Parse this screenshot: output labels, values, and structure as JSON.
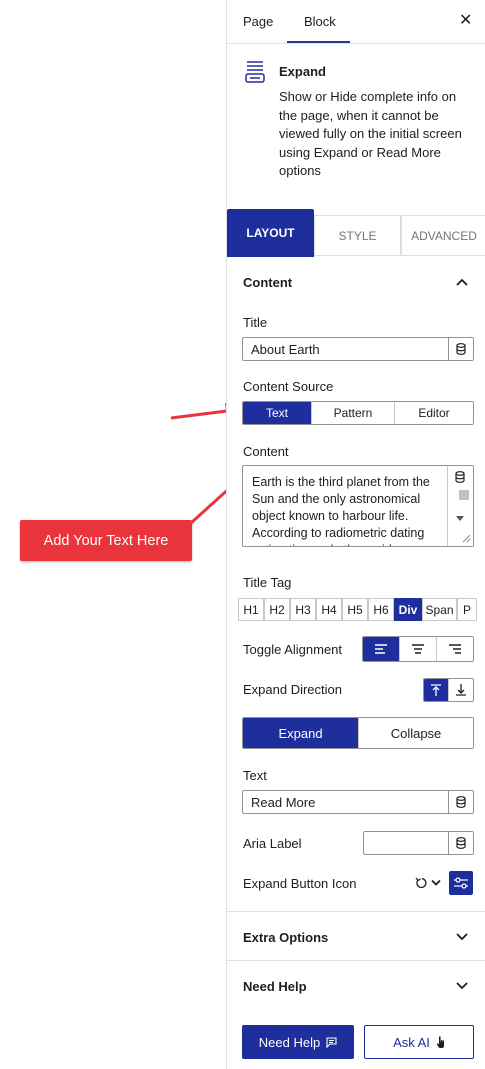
{
  "header": {
    "tabs": [
      "Page",
      "Block"
    ],
    "active_tab": "Block"
  },
  "block": {
    "title": "Expand",
    "description": "Show or Hide complete info on the page, when it cannot be viewed fully on the initial screen using Expand or Read More options"
  },
  "inspector_tabs": [
    "LAYOUT",
    "STYLE",
    "ADVANCED"
  ],
  "content_section": {
    "title": "Content",
    "title_label": "Title",
    "title_value": "About Earth",
    "source_label": "Content Source",
    "source_options": [
      "Text",
      "Pattern",
      "Editor"
    ],
    "source_selected": "Text",
    "content_label": "Content",
    "content_value": "Earth is the third planet from the Sun and the only astronomical object known to harbour life. According to radiometric dating estimation and other evidence",
    "title_tag_label": "Title Tag",
    "title_tags": [
      "H1",
      "H2",
      "H3",
      "H4",
      "H5",
      "H6",
      "Div",
      "Span",
      "P"
    ],
    "title_tag_selected": "Div",
    "toggle_alignment_label": "Toggle Alignment",
    "expand_direction_label": "Expand Direction",
    "state_options": [
      "Expand",
      "Collapse"
    ],
    "state_selected": "Expand",
    "text_label": "Text",
    "text_value": "Read More",
    "aria_label": "Aria Label",
    "aria_value": "",
    "expand_icon_label": "Expand Button Icon"
  },
  "extra_options": {
    "title": "Extra Options"
  },
  "need_help": {
    "title": "Need Help",
    "help_button": "Need Help",
    "ai_button": "Ask AI"
  },
  "annotation": {
    "callout_text": "Add Your Text Here",
    "color": "#e8343a"
  },
  "colors": {
    "accent": "#1e2e9c"
  }
}
